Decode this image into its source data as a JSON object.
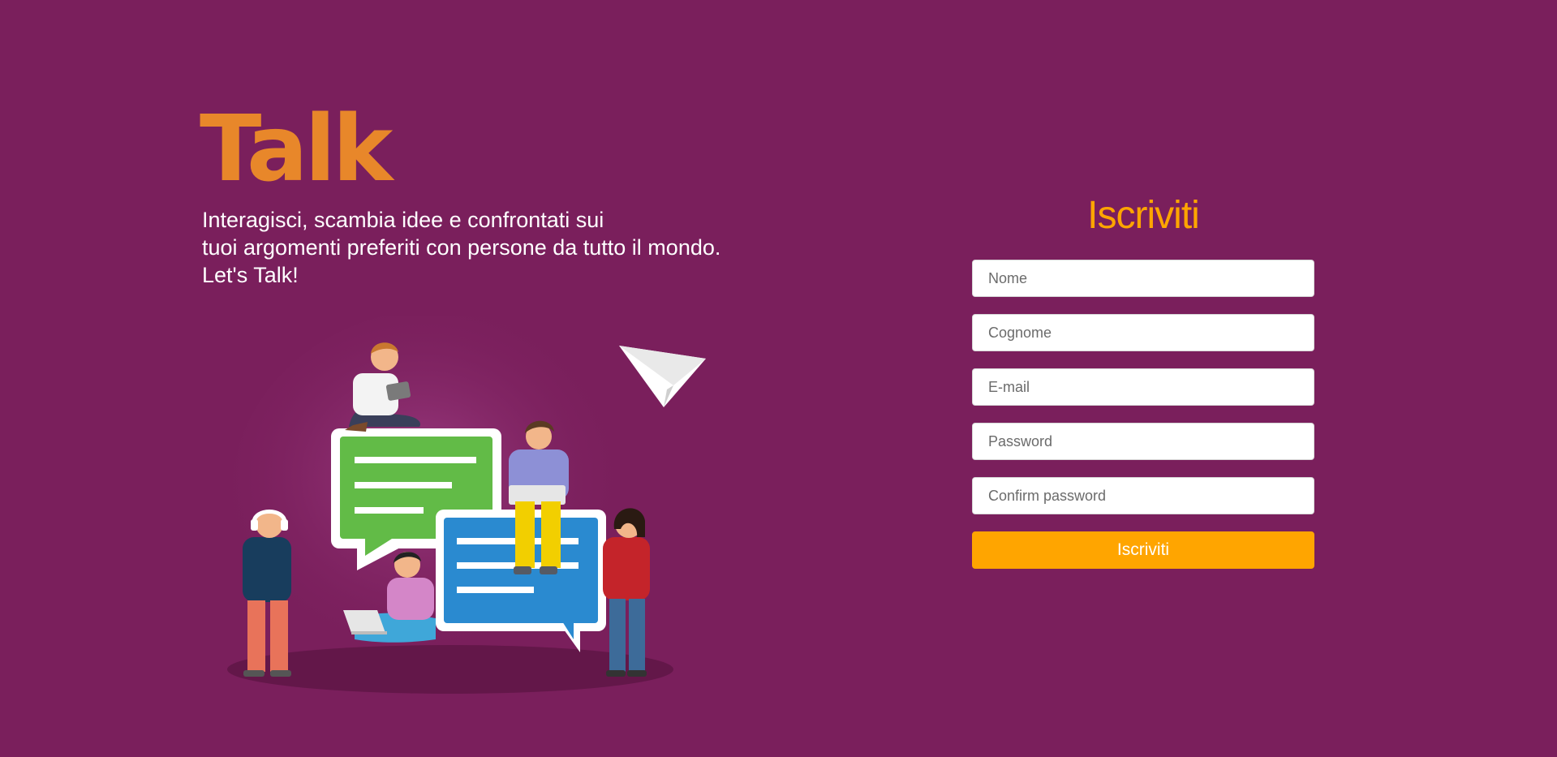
{
  "brand": {
    "logo_text": "Talk",
    "tagline_lines": [
      "Interagisci, scambia idee e confrontati sui",
      "tuoi argomenti preferiti con persone da tutto il mondo.",
      "Let's Talk!"
    ]
  },
  "illustration": {
    "icon": "people-chatting-illustration",
    "paper_plane_icon": "paper-plane-icon"
  },
  "signup": {
    "title": "Iscriviti",
    "fields": {
      "nome_placeholder": "Nome",
      "cognome_placeholder": "Cognome",
      "email_placeholder": "E-mail",
      "password_placeholder": "Password",
      "confirm_password_placeholder": "Confirm password"
    },
    "submit_label": "Iscriviti"
  },
  "colors": {
    "background": "#7a1f5c",
    "brand_orange": "#e8872a",
    "accent": "#ffa500",
    "bubble_green": "#62bb47",
    "bubble_blue": "#2a8ad0"
  }
}
